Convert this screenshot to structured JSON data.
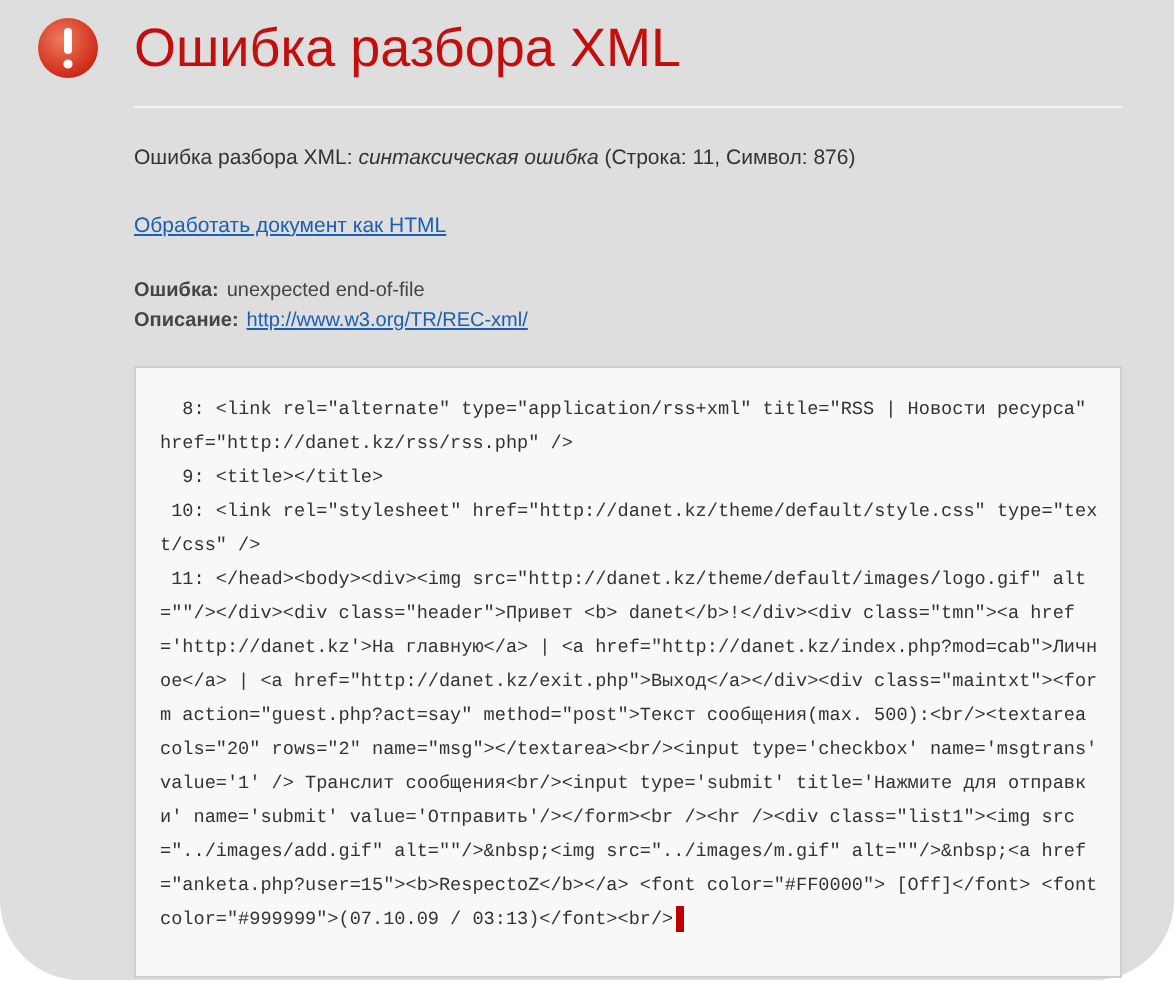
{
  "title": "Ошибка разбора XML",
  "message": "Ошибка разбора XML: *синтаксическая ошибка* (Строка: 11, Символ: 876)",
  "html_link": "Обработать документ как HTML",
  "details": [
    {
      "label": "Ошибка:",
      "value": "unexpected end-of-file",
      "kind": "text"
    },
    {
      "label": "Описание:",
      "value": "http://www.w3.org/TR/REC-xml/",
      "kind": "link"
    }
  ],
  "source_lines": [
    {
      "number": "8:",
      "text": "<link rel=\"alternate\" type=\"application/rss+xml\" title=\"RSS | Новости ресурса\" href=\"http://danet.kz/rss/rss.php\" />"
    },
    {
      "number": "9:",
      "text": "<title></title>"
    },
    {
      "number": "10:",
      "text": "<link rel=\"stylesheet\" href=\"http://danet.kz/theme/default/style.css\" type=\"text/css\" />"
    },
    {
      "number": "11:",
      "text": "</head><body><div><img src=\"http://danet.kz/theme/default/images/logo.gif\" alt=\"\"/></div><div class=\"header\">Привет <b> danet</b>!</div><div class=\"tmn\"><a href='http://danet.kz'>На главную</a> | <a href=\"http://danet.kz/index.php?mod=cab\">Личное</a> | <a href=\"http://danet.kz/exit.php\">Выход</a></div><div class=\"maintxt\"><form action=\"guest.php?act=say\" method=\"post\">Текст сообщения(max. 500):<br/><textarea cols=\"20\" rows=\"2\" name=\"msg\"></textarea><br/><input type='checkbox' name='msgtrans' value='1' /> Транслит сообщения<br/><input type='submit' title='Нажмите для отправки' name='submit' value='Отправить'/></form><br /><hr /><div class=\"list1\"><img src=\"../images/add.gif\" alt=\"\"/>&nbsp;<img src=\"../images/m.gif\" alt=\"\"/>&nbsp;<a href=\"anketa.php?user=15\"><b>RespectoZ</b></a> <font color=\"#FF0000\"> [Off]</font> <font color=\"#999999\">(07.10.09 / 03:13)</font><br/>"
    }
  ]
}
